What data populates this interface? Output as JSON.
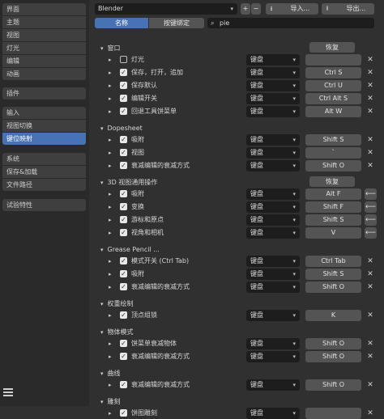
{
  "sidebar": {
    "items": [
      {
        "label": "界面",
        "group": "a"
      },
      {
        "label": "主题",
        "group": "a"
      },
      {
        "label": "视图",
        "group": "a"
      },
      {
        "label": "灯光",
        "group": "a"
      },
      {
        "label": "编辑",
        "group": "a"
      },
      {
        "label": "动画",
        "group": "a"
      },
      {
        "label": "插件",
        "group": "b"
      },
      {
        "label": "输入",
        "group": "c"
      },
      {
        "label": "视图切换",
        "group": "c"
      },
      {
        "label": "键位映射",
        "group": "c",
        "active": true
      },
      {
        "label": "系统",
        "group": "d"
      },
      {
        "label": "保存&加载",
        "group": "d"
      },
      {
        "label": "文件路径",
        "group": "d"
      },
      {
        "label": "试验特性",
        "group": "e"
      }
    ]
  },
  "header": {
    "preset": "Blender",
    "add": "+",
    "remove": "−",
    "import": "导入...",
    "export": "导出..."
  },
  "filter": {
    "tab_name": "名称",
    "tab_key": "按键绑定",
    "search_value": "pie"
  },
  "sections": [
    {
      "title": "窗口",
      "restore": "恢复",
      "rows": [
        {
          "label": "灯光",
          "checked": false,
          "type": "键盘",
          "key": "",
          "x": true
        },
        {
          "label": "保存，打开，追加",
          "checked": true,
          "type": "键盘",
          "key": "Ctrl S",
          "x": true
        },
        {
          "label": "保存默认",
          "checked": true,
          "type": "键盘",
          "key": "Ctrl U",
          "x": true
        },
        {
          "label": "编辑开关",
          "checked": true,
          "type": "键盘",
          "key": "Ctrl Alt S",
          "x": true
        },
        {
          "label": "回退工具饼菜单",
          "checked": true,
          "type": "键盘",
          "key": "Alt W",
          "x": true
        }
      ]
    },
    {
      "title": "Dopesheet",
      "restore": "",
      "rows": [
        {
          "label": "吸附",
          "checked": true,
          "type": "键盘",
          "key": "Shift S",
          "x": true
        },
        {
          "label": "视图",
          "checked": true,
          "type": "键盘",
          "key": "`",
          "x": true
        },
        {
          "label": "衰减编辑的衰减方式",
          "checked": true,
          "type": "键盘",
          "key": "Shift O",
          "x": true
        }
      ]
    },
    {
      "title": "3D 视图通用操作",
      "restore": "恢复",
      "rows": [
        {
          "label": "吸附",
          "checked": true,
          "type": "键盘",
          "key": "Alt F",
          "arrow": true
        },
        {
          "label": "变换",
          "checked": true,
          "type": "键盘",
          "key": "Shift F",
          "arrow": true
        },
        {
          "label": "游标和原点",
          "checked": true,
          "type": "键盘",
          "key": "Shift S",
          "arrow": true
        },
        {
          "label": "视角和相机",
          "checked": true,
          "type": "键盘",
          "key": "V",
          "arrow": true
        }
      ]
    },
    {
      "title": "Grease Pencil ...",
      "restore": "",
      "rows": [
        {
          "label": "模式开关 (Ctrl Tab)",
          "checked": true,
          "type": "键盘",
          "key": "Ctrl Tab",
          "x": true
        },
        {
          "label": "吸附",
          "checked": true,
          "type": "键盘",
          "key": "Shift S",
          "x": true
        },
        {
          "label": "衰减编辑的衰减方式",
          "checked": true,
          "type": "键盘",
          "key": "Shift O",
          "x": true
        }
      ]
    },
    {
      "title": "权重绘制",
      "restore": "",
      "rows": [
        {
          "label": "顶点组锁",
          "checked": true,
          "type": "键盘",
          "key": "K",
          "x": true
        }
      ]
    },
    {
      "title": "物体模式",
      "restore": "",
      "rows": [
        {
          "label": "饼菜单衰减物体",
          "checked": true,
          "type": "键盘",
          "key": "Shift O",
          "x": true
        },
        {
          "label": "衰减编辑的衰减方式",
          "checked": true,
          "type": "键盘",
          "key": "Shift O",
          "x": true
        }
      ]
    },
    {
      "title": "曲线",
      "restore": "",
      "rows": [
        {
          "label": "衰减编辑的衰减方式",
          "checked": true,
          "type": "键盘",
          "key": "Shift O",
          "x": true
        }
      ]
    },
    {
      "title": "雕刻",
      "restore": "",
      "rows": [
        {
          "label": "饼图雕刻",
          "checked": true,
          "type": "键盘",
          "key": "",
          "x": true
        }
      ]
    }
  ]
}
